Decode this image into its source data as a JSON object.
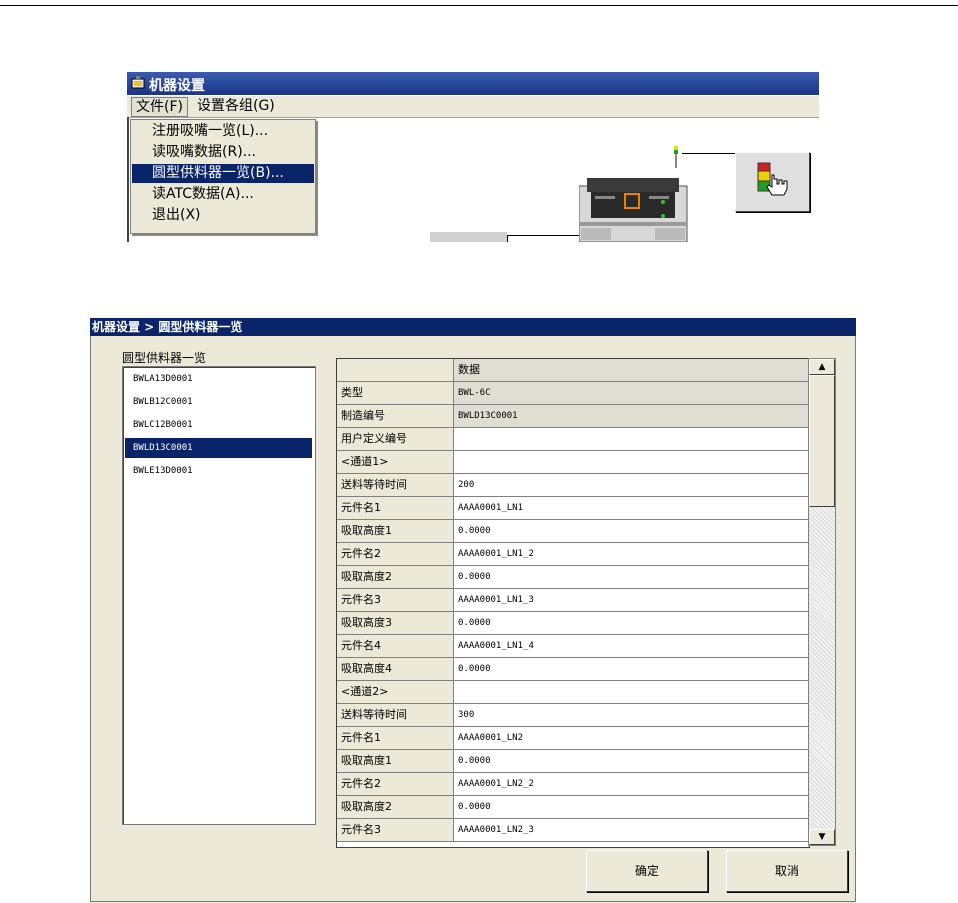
{
  "menu_screenshot": {
    "window_title": "机器设置",
    "menubar": [
      "文件(F)",
      "设置各组(G)"
    ],
    "file_menu_items": [
      {
        "label": "注册吸嘴一览(L)...",
        "active": false
      },
      {
        "label": "读吸嘴数据(R)...",
        "active": false
      },
      {
        "label": "圆型供料器一览(B)...",
        "active": true
      },
      {
        "label": "读ATC数据(A)...",
        "active": false
      },
      {
        "label": "退出(X)",
        "active": false
      }
    ]
  },
  "dialog": {
    "title": "机器设置 > 圆型供料器一览",
    "group_label": "圆型供料器一览",
    "feeders": [
      "BWLA13D0001",
      "BWLB12C0001",
      "BWLC12B0001",
      "BWLD13C0001",
      "BWLE13D0001"
    ],
    "selected_feeder_index": 3,
    "table_header": {
      "label": "",
      "value": "数据"
    },
    "rows": [
      {
        "label": "类型",
        "value": "BWL-6C",
        "readonly": true
      },
      {
        "label": "制造编号",
        "value": "BWLD13C0001",
        "readonly": true
      },
      {
        "label": "用户定义编号",
        "value": ""
      },
      {
        "label": "<通道1>",
        "value": ""
      },
      {
        "label": "送料等待时间",
        "value": "200"
      },
      {
        "label": "元件名1",
        "value": "AAAA0001_LN1"
      },
      {
        "label": "吸取高度1",
        "value": "0.0000"
      },
      {
        "label": "元件名2",
        "value": "AAAA0001_LN1_2"
      },
      {
        "label": "吸取高度2",
        "value": "0.0000"
      },
      {
        "label": "元件名3",
        "value": "AAAA0001_LN1_3"
      },
      {
        "label": "吸取高度3",
        "value": "0.0000"
      },
      {
        "label": "元件名4",
        "value": "AAAA0001_LN1_4"
      },
      {
        "label": "吸取高度4",
        "value": "0.0000"
      },
      {
        "label": "<通道2>",
        "value": ""
      },
      {
        "label": "送料等待时间",
        "value": "300"
      },
      {
        "label": "元件名1",
        "value": "AAAA0001_LN2"
      },
      {
        "label": "吸取高度1",
        "value": "0.0000"
      },
      {
        "label": "元件名2",
        "value": "AAAA0001_LN2_2"
      },
      {
        "label": "吸取高度2",
        "value": "0.0000"
      },
      {
        "label": "元件名3",
        "value": "AAAA0001_LN2_3"
      }
    ],
    "ok_label": "确定",
    "cancel_label": "取消",
    "scroll_up_glyph": "▲",
    "scroll_down_glyph": "▼"
  },
  "colors": {
    "selection": "#0a246a",
    "title_bar": "#0a246a",
    "window_bg": "#ece9d8"
  }
}
